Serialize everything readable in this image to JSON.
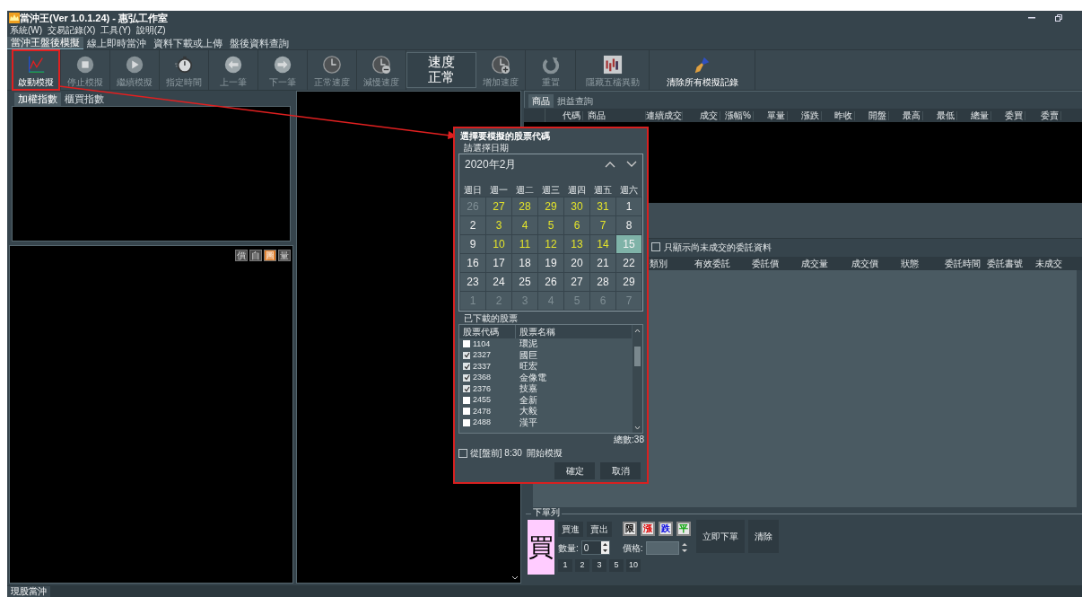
{
  "window": {
    "title": "當沖王(Ver 1.0.1.24) - 惠弘工作室"
  },
  "menu": [
    "系統(W)",
    "交易記錄(X)",
    "工具(Y)",
    "說明(Z)"
  ],
  "main_tabs": [
    {
      "label": "當沖王盤後模擬",
      "selected": true
    },
    {
      "label": "線上即時當沖",
      "selected": false
    },
    {
      "label": "資料下載或上傳",
      "selected": false
    },
    {
      "label": "盤後資料查詢",
      "selected": false
    }
  ],
  "toolbar": [
    {
      "kind": "button",
      "label": "啟動模擬",
      "disabled": false
    },
    {
      "kind": "button",
      "label": "停止模擬",
      "disabled": true
    },
    {
      "kind": "button",
      "label": "繼續模擬",
      "disabled": true
    },
    {
      "kind": "button",
      "label": "指定時間",
      "disabled": true
    },
    {
      "kind": "button",
      "label": "上一筆",
      "disabled": true
    },
    {
      "kind": "button",
      "label": "下一筆",
      "disabled": true
    },
    {
      "kind": "button",
      "label": "正常速度",
      "disabled": true
    },
    {
      "kind": "button",
      "label": "減慢速度",
      "disabled": true
    },
    {
      "kind": "speed",
      "label": "速度",
      "value": "正常"
    },
    {
      "kind": "button",
      "label": "增加速度",
      "disabled": true
    },
    {
      "kind": "button",
      "label": "重置",
      "disabled": true
    },
    {
      "kind": "button",
      "label": "隱藏五檔異動",
      "disabled": true
    },
    {
      "kind": "button",
      "label": "清除所有模擬記錄",
      "disabled": false
    }
  ],
  "left_panel": {
    "tabs": [
      {
        "label": "加權指數",
        "selected": true
      },
      {
        "label": "櫃買指數",
        "selected": false
      }
    ],
    "chart_buttons": [
      {
        "label": "價",
        "selected": false
      },
      {
        "label": "自",
        "selected": false
      },
      {
        "label": "圖",
        "selected": true
      },
      {
        "label": "量",
        "selected": false
      }
    ]
  },
  "quote_panel": {
    "tabs": [
      {
        "label": "商品",
        "selected": true
      },
      {
        "label": "損益查詢",
        "selected": false
      }
    ],
    "columns": [
      "",
      "代碼",
      "商品",
      "連續成交",
      "成交",
      "漲幅%",
      "單量",
      "漲跌",
      "昨收",
      "開盤",
      "最高",
      "最低",
      "總量",
      "委買",
      "委賣"
    ]
  },
  "orders": {
    "filter": {
      "label": "只顯示尚未成交的委託資料",
      "checked": false
    },
    "columns": [
      "類別",
      "有效委託",
      "委託價",
      "成交量",
      "成交價",
      "狀態",
      "委託時間",
      "委託書號",
      "未成交"
    ]
  },
  "order_bar": {
    "title": "下單列",
    "side": "買",
    "actions": [
      "買進",
      "賣出"
    ],
    "price_types": [
      {
        "label": "限",
        "color": "#000000"
      },
      {
        "label": "漲",
        "color": "#e00000"
      },
      {
        "label": "跌",
        "color": "#0000e0"
      },
      {
        "label": "平",
        "color": "#00a000"
      }
    ],
    "quantity": {
      "label": "數量:",
      "value": "0"
    },
    "price": {
      "label": "價格:"
    },
    "quick_quantities": [
      "1",
      "2",
      "3",
      "5",
      "10"
    ],
    "buttons": [
      "立即下單",
      "清除"
    ]
  },
  "status_bar": {
    "tabs": [
      {
        "label": "現股當沖",
        "selected": true
      }
    ]
  },
  "dialog": {
    "title": "選擇要模擬的股票代碼",
    "date_group": "請選擇日期",
    "month": "2020年2月",
    "weekdays": [
      "週日",
      "週一",
      "週二",
      "週三",
      "週四",
      "週五",
      "週六"
    ],
    "days": [
      {
        "text": "26",
        "kind": "muted",
        "selected": false
      },
      {
        "text": "27",
        "kind": "available",
        "selected": false
      },
      {
        "text": "28",
        "kind": "available",
        "selected": false
      },
      {
        "text": "29",
        "kind": "available",
        "selected": false
      },
      {
        "text": "30",
        "kind": "available",
        "selected": false
      },
      {
        "text": "31",
        "kind": "available",
        "selected": false
      },
      {
        "text": "1",
        "kind": "normal",
        "selected": false
      },
      {
        "text": "2",
        "kind": "normal",
        "selected": false
      },
      {
        "text": "3",
        "kind": "available",
        "selected": false
      },
      {
        "text": "4",
        "kind": "available",
        "selected": false
      },
      {
        "text": "5",
        "kind": "available",
        "selected": false
      },
      {
        "text": "6",
        "kind": "available",
        "selected": false
      },
      {
        "text": "7",
        "kind": "available",
        "selected": false
      },
      {
        "text": "8",
        "kind": "normal",
        "selected": false
      },
      {
        "text": "9",
        "kind": "normal",
        "selected": false
      },
      {
        "text": "10",
        "kind": "available",
        "selected": false
      },
      {
        "text": "11",
        "kind": "available",
        "selected": false
      },
      {
        "text": "12",
        "kind": "available",
        "selected": false
      },
      {
        "text": "13",
        "kind": "available",
        "selected": false
      },
      {
        "text": "14",
        "kind": "available",
        "selected": false
      },
      {
        "text": "15",
        "kind": "normal",
        "selected": true
      },
      {
        "text": "16",
        "kind": "normal",
        "selected": false
      },
      {
        "text": "17",
        "kind": "normal",
        "selected": false
      },
      {
        "text": "18",
        "kind": "normal",
        "selected": false
      },
      {
        "text": "19",
        "kind": "normal",
        "selected": false
      },
      {
        "text": "20",
        "kind": "normal",
        "selected": false
      },
      {
        "text": "21",
        "kind": "normal",
        "selected": false
      },
      {
        "text": "22",
        "kind": "normal",
        "selected": false
      },
      {
        "text": "23",
        "kind": "normal",
        "selected": false
      },
      {
        "text": "24",
        "kind": "normal",
        "selected": false
      },
      {
        "text": "25",
        "kind": "normal",
        "selected": false
      },
      {
        "text": "26",
        "kind": "normal",
        "selected": false
      },
      {
        "text": "27",
        "kind": "normal",
        "selected": false
      },
      {
        "text": "28",
        "kind": "normal",
        "selected": false
      },
      {
        "text": "29",
        "kind": "normal",
        "selected": false
      },
      {
        "text": "1",
        "kind": "muted",
        "selected": false
      },
      {
        "text": "2",
        "kind": "muted",
        "selected": false
      },
      {
        "text": "3",
        "kind": "muted",
        "selected": false
      },
      {
        "text": "4",
        "kind": "muted",
        "selected": false
      },
      {
        "text": "5",
        "kind": "muted",
        "selected": false
      },
      {
        "text": "6",
        "kind": "muted",
        "selected": false
      },
      {
        "text": "7",
        "kind": "muted",
        "selected": false
      }
    ],
    "stocks_group": "已下載的股票",
    "stock_columns": [
      "股票代碼",
      "股票名稱"
    ],
    "stocks": [
      {
        "code": "1104",
        "name": "環泥",
        "checked": false
      },
      {
        "code": "2327",
        "name": "國巨",
        "checked": true
      },
      {
        "code": "2337",
        "name": "旺宏",
        "checked": true
      },
      {
        "code": "2368",
        "name": "金像電",
        "checked": true
      },
      {
        "code": "2376",
        "name": "技嘉",
        "checked": true
      },
      {
        "code": "2455",
        "name": "全新",
        "checked": false
      },
      {
        "code": "2478",
        "name": "大毅",
        "checked": false
      },
      {
        "code": "2488",
        "name": "漢平",
        "checked": false
      }
    ],
    "total": "總數:38",
    "premarket": {
      "label": "從[盤前] 8:30  開始模擬",
      "checked": false
    },
    "buttons": [
      "確定",
      "取消"
    ]
  }
}
